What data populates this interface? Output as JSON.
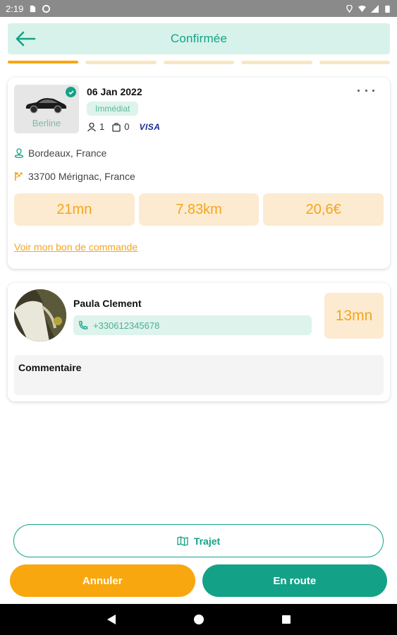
{
  "status_bar": {
    "time": "2:19"
  },
  "header": {
    "title": "Confirmée"
  },
  "steps": [
    {
      "state": "active"
    },
    {
      "state": "inactive"
    },
    {
      "state": "inactive"
    },
    {
      "state": "inactive"
    },
    {
      "state": "inactive"
    }
  ],
  "ride": {
    "vehicle_type": "Berline",
    "date": "06 Jan 2022",
    "booking_type": "Immédiat",
    "passengers": "1",
    "luggage": "0",
    "payment": "VISA",
    "from": "Bordeaux, France",
    "to": "33700 Mérignac, France",
    "duration": "21mn",
    "distance": "7.83km",
    "price": "20,6€",
    "order_link": "Voir mon bon de commande"
  },
  "driver": {
    "name": "Paula Clement",
    "phone": "+330612345678",
    "eta": "13mn",
    "comment_label": "Commentaire"
  },
  "actions": {
    "route_label": "Trajet",
    "cancel_label": "Annuler",
    "go_label": "En route"
  },
  "colors": {
    "primary": "#13a287",
    "accent": "#f8a70f",
    "header_bg": "#d7f2ea",
    "stat_bg": "#fcebd0"
  },
  "icons": {
    "back": "arrow-left-icon",
    "check": "check-circle-icon",
    "more": "more-horizontal-icon",
    "passenger": "user-icon",
    "luggage": "bag-icon",
    "pickup": "pin-icon",
    "dropoff": "flag-icon",
    "phone": "phone-icon",
    "map": "map-icon"
  }
}
